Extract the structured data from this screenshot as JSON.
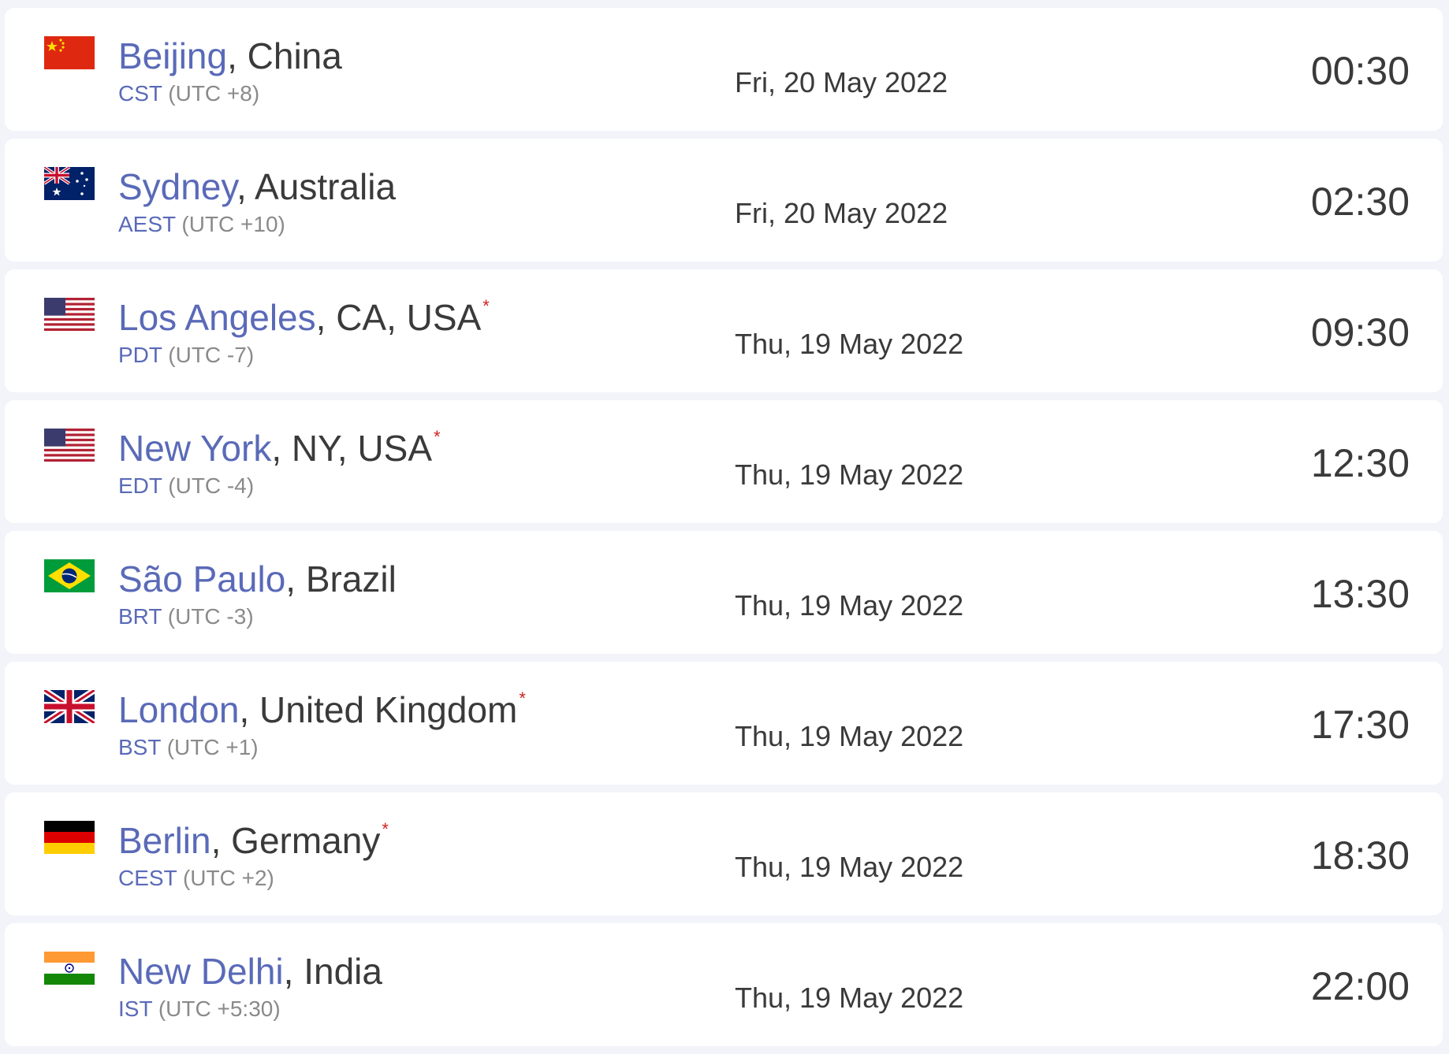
{
  "rows": [
    {
      "city": "Beijing",
      "rest": ", China",
      "dst": "",
      "abbr": "CST",
      "offset": " (UTC +8)",
      "date": "Fri, 20 May 2022",
      "time": "00:30",
      "flag": "china-flag-icon"
    },
    {
      "city": "Sydney",
      "rest": ", Australia",
      "dst": "",
      "abbr": "AEST",
      "offset": " (UTC +10)",
      "date": "Fri, 20 May 2022",
      "time": "02:30",
      "flag": "australia-flag-icon"
    },
    {
      "city": "Los Angeles",
      "rest": ", CA, USA",
      "dst": "*",
      "abbr": "PDT",
      "offset": " (UTC -7)",
      "date": "Thu, 19 May 2022",
      "time": "09:30",
      "flag": "usa-flag-icon"
    },
    {
      "city": "New York",
      "rest": ", NY, USA",
      "dst": "*",
      "abbr": "EDT",
      "offset": " (UTC -4)",
      "date": "Thu, 19 May 2022",
      "time": "12:30",
      "flag": "usa-flag-icon"
    },
    {
      "city": "São Paulo",
      "rest": ", Brazil",
      "dst": "",
      "abbr": "BRT",
      "offset": " (UTC -3)",
      "date": "Thu, 19 May 2022",
      "time": "13:30",
      "flag": "brazil-flag-icon"
    },
    {
      "city": "London",
      "rest": ", United Kingdom",
      "dst": "*",
      "abbr": "BST",
      "offset": " (UTC +1)",
      "date": "Thu, 19 May 2022",
      "time": "17:30",
      "flag": "uk-flag-icon"
    },
    {
      "city": "Berlin",
      "rest": ", Germany",
      "dst": "*",
      "abbr": "CEST",
      "offset": " (UTC +2)",
      "date": "Thu, 19 May 2022",
      "time": "18:30",
      "flag": "germany-flag-icon"
    },
    {
      "city": "New Delhi",
      "rest": ", India",
      "dst": "",
      "abbr": "IST",
      "offset": " (UTC +5:30)",
      "date": "Thu, 19 May 2022",
      "time": "22:00",
      "flag": "india-flag-icon"
    }
  ],
  "colors": {
    "city_link": "#5a6ab8",
    "dst_marker": "#d21f1f",
    "text": "#3a3a3a",
    "muted": "#8a8a8a"
  }
}
